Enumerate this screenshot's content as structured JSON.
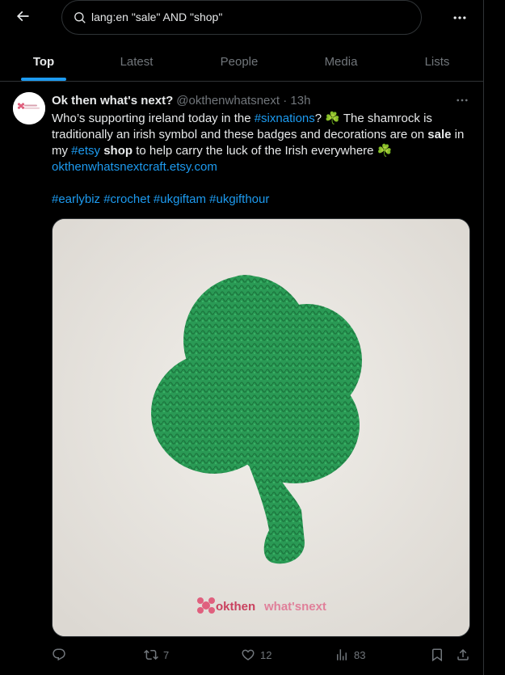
{
  "search": {
    "query": "lang:en \"sale\" AND \"shop\""
  },
  "tabs": [
    {
      "label": "Top"
    },
    {
      "label": "Latest"
    },
    {
      "label": "People"
    },
    {
      "label": "Media"
    },
    {
      "label": "Lists"
    }
  ],
  "tweet": {
    "author_name": "Ok then what's next?",
    "meta": "@okthenwhatsnext · 13h",
    "text": {
      "p1": "Who’s supporting ireland today in the ",
      "tag_sixnations": "#sixnations",
      "p2": "? ",
      "shamrock": "☘️",
      "p3": " The shamrock is traditionally an irish symbol and these badges and decorations are on ",
      "sale": "sale",
      "p4": " in my ",
      "tag_etsy": "#etsy",
      "shop": "shop",
      "p5": " to help carry the luck of the Irish everywhere ",
      "url": "okthenwhatsnextcraft.etsy.com",
      "hashtags": [
        "#earlybiz",
        "#crochet",
        "#ukgiftam",
        "#ukgifthour"
      ]
    },
    "image_watermark": {
      "part1": "okthen",
      "part2": "what'snext"
    },
    "stats": {
      "reposts": "7",
      "likes": "12",
      "views": "83"
    }
  },
  "colors": {
    "background": "#000000",
    "text": "#e7e9ea",
    "muted": "#71767b",
    "accent": "#1d9bf0",
    "border": "#2f3336"
  },
  "icons": [
    "back-arrow-icon",
    "search-icon",
    "more-icon",
    "reply-icon",
    "repost-icon",
    "like-icon",
    "views-icon",
    "bookmark-icon",
    "share-icon"
  ]
}
